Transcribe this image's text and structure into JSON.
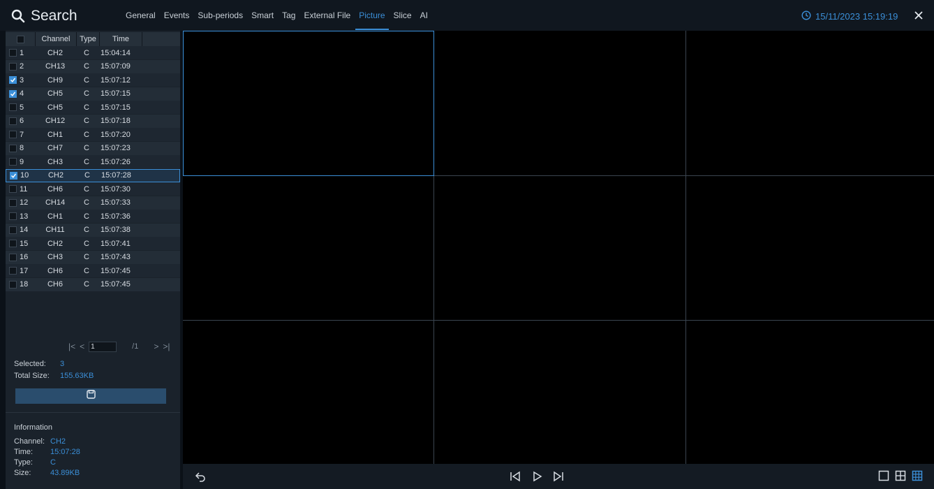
{
  "header": {
    "title": "Search",
    "tabs": [
      "General",
      "Events",
      "Sub-periods",
      "Smart",
      "Tag",
      "External File",
      "Picture",
      "Slice",
      "AI"
    ],
    "active_tab": "Picture",
    "datetime": "15/11/2023 15:19:19"
  },
  "table": {
    "columns": [
      "Channel",
      "Type",
      "Time"
    ],
    "rows": [
      {
        "no": "1",
        "channel": "CH2",
        "type": "C",
        "time": "15:04:14",
        "checked": false
      },
      {
        "no": "2",
        "channel": "CH13",
        "type": "C",
        "time": "15:07:09",
        "checked": false
      },
      {
        "no": "3",
        "channel": "CH9",
        "type": "C",
        "time": "15:07:12",
        "checked": true
      },
      {
        "no": "4",
        "channel": "CH5",
        "type": "C",
        "time": "15:07:15",
        "checked": true
      },
      {
        "no": "5",
        "channel": "CH5",
        "type": "C",
        "time": "15:07:15",
        "checked": false
      },
      {
        "no": "6",
        "channel": "CH12",
        "type": "C",
        "time": "15:07:18",
        "checked": false
      },
      {
        "no": "7",
        "channel": "CH1",
        "type": "C",
        "time": "15:07:20",
        "checked": false
      },
      {
        "no": "8",
        "channel": "CH7",
        "type": "C",
        "time": "15:07:23",
        "checked": false
      },
      {
        "no": "9",
        "channel": "CH3",
        "type": "C",
        "time": "15:07:26",
        "checked": false
      },
      {
        "no": "10",
        "channel": "CH2",
        "type": "C",
        "time": "15:07:28",
        "checked": true,
        "selected": true
      },
      {
        "no": "11",
        "channel": "CH6",
        "type": "C",
        "time": "15:07:30",
        "checked": false
      },
      {
        "no": "12",
        "channel": "CH14",
        "type": "C",
        "time": "15:07:33",
        "checked": false
      },
      {
        "no": "13",
        "channel": "CH1",
        "type": "C",
        "time": "15:07:36",
        "checked": false
      },
      {
        "no": "14",
        "channel": "CH11",
        "type": "C",
        "time": "15:07:38",
        "checked": false
      },
      {
        "no": "15",
        "channel": "CH2",
        "type": "C",
        "time": "15:07:41",
        "checked": false
      },
      {
        "no": "16",
        "channel": "CH3",
        "type": "C",
        "time": "15:07:43",
        "checked": false
      },
      {
        "no": "17",
        "channel": "CH6",
        "type": "C",
        "time": "15:07:45",
        "checked": false
      },
      {
        "no": "18",
        "channel": "CH6",
        "type": "C",
        "time": "15:07:45",
        "checked": false
      }
    ]
  },
  "pager": {
    "current": "1",
    "total": "/1"
  },
  "summary": {
    "selected_label": "Selected:",
    "selected_value": "3",
    "total_size_label": "Total Size:",
    "total_size_value": "155.63KB"
  },
  "information": {
    "heading": "Information",
    "channel_label": "Channel:",
    "channel_value": "CH2",
    "time_label": "Time:",
    "time_value": "15:07:28",
    "type_label": "Type:",
    "type_value": "C",
    "size_label": "Size:",
    "size_value": "43.89KB"
  },
  "icons": {
    "search": "search-icon",
    "clock": "clock-icon",
    "close": "close-icon",
    "save": "save-icon",
    "back": "back-icon",
    "prev": "previous-icon",
    "play": "play-icon",
    "next": "next-icon",
    "layout1": "single-layout-icon",
    "layout4": "quad-layout-icon",
    "layout9": "nine-layout-icon"
  },
  "colors": {
    "accent": "#3b8fd8",
    "background": "#0b1118",
    "panel": "#1a222b"
  },
  "grid": {
    "layout": "3x3",
    "active_cell": 1
  }
}
